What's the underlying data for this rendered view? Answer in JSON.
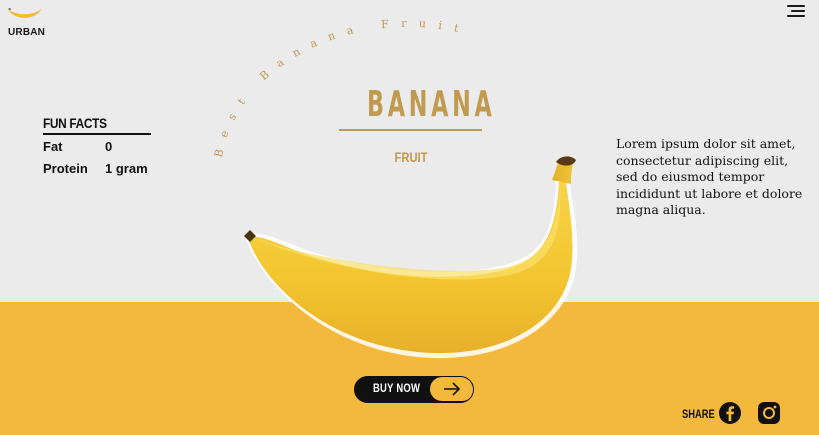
{
  "brand": {
    "name": "URBAN",
    "logo_icon": "banana-logo-icon"
  },
  "header": {
    "menu_icon": "hamburger-menu-icon"
  },
  "hero": {
    "arc_text": "Best Banana Fruit",
    "title": "BANANA",
    "subtitle": "FRUIT",
    "image": "banana-image"
  },
  "fun_facts": {
    "title": "FUN FACTS",
    "rows": [
      {
        "label": "Fat",
        "value": "0"
      },
      {
        "label": "Protein",
        "value": "1 gram"
      }
    ]
  },
  "description": "Lorem ipsum dolor sit amet, consectetur adipiscing elit, sed do eiusmod tempor incididunt ut labore et dolore magna aliqua.",
  "cta": {
    "label": "BUY NOW",
    "icon": "arrow-right-icon"
  },
  "share": {
    "label": "SHARE",
    "networks": [
      {
        "name": "facebook",
        "icon": "facebook-icon"
      },
      {
        "name": "instagram",
        "icon": "instagram-icon"
      }
    ]
  },
  "colors": {
    "accent": "#f3b83c",
    "gold_text": "#c09a4f",
    "background": "#ebebeb",
    "dark": "#111111"
  }
}
